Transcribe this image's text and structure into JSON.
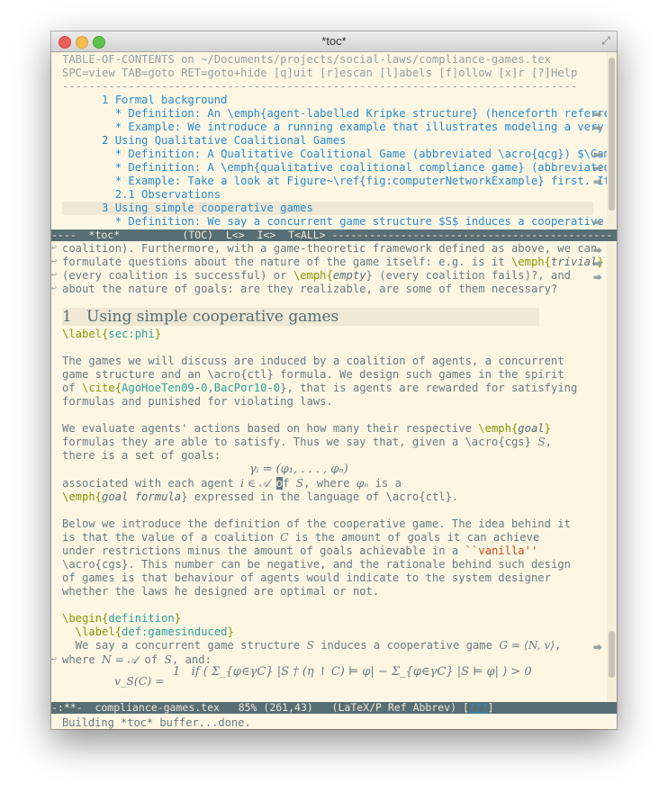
{
  "window": {
    "title": "*toc*"
  },
  "toc": {
    "header1": "TABLE-OF-CONTENTS on ~/Documents/projects/social-laws/compliance-games.tex",
    "header2": "SPC=view TAB=goto RET=goto+hide [q]uit [r]escan [l]abels [f]ollow [x]r [?]Help",
    "rule": "------------------------------------------------------------------------------",
    "entries": [
      "      1 Formal background",
      "        * Definition: An \\emph{agent-labelled Kripke structure} (henceforth referred",
      "        * Example: We introduce a running example that illustrates modeling a very si",
      "      2 Using Qualitative Coalitional Games",
      "        * Definition: A Qualitative Coalitional Game (abbreviated \\acro{qcg}) $\\Gamma",
      "        * Definition: A \\emph{qualitative coalitional compliance game} (abbreviated \\",
      "        * Example: Take a look at Figure~\\ref{fig:computerNetworkExample} first. It i",
      "        2.1 Observations",
      "      3 Using simple cooperative games",
      "        * Definition: We say a concurrent game structure $S$ induces a cooperative ga"
    ]
  },
  "modeline_top": "----  *toc*          (TOC)  L<>  I<>  T<ALL> ---------------------------------------------",
  "text": {
    "l1": "coalition). Furthermore, with a game-theoretic framework defined as above, we can",
    "l2": "formulate questions about the nature of the game itself: e.g. is it ",
    "l2_cmd": "\\emph{",
    "l2_arg": "trivial",
    "l2_end": "}",
    "l3_a": "(every coalition is successful) or ",
    "l3_cmd": "\\emph{",
    "l3_arg": "empty",
    "l3_b": "} (every coalition fails)?, and",
    "l4": "about the nature of goals: are they realizable, are some of them necessary?",
    "section": "1   Using simple cooperative games",
    "label_cmd": "\\label{",
    "label_arg": "sec:phi",
    "label_end": "}",
    "p1_1": "The games we will discuss are induced by a coalition of agents, a concurrent",
    "p1_2": "game structure and an \\acro{ctl} formula. We design such games in the spirit",
    "p1_3a": "of ",
    "p1_3cmd": "\\cite{",
    "p1_3arg": "AgoHoeTen09-0,BacPor10-0",
    "p1_3b": "}, that is agents are rewarded for satisfying",
    "p1_4": "formulas and punished for violating laws.",
    "p2_1a": "We evaluate agents' actions based on how many their respective ",
    "p2_1cmd": "\\emph{",
    "p2_1arg": "goal",
    "p2_1b": "}",
    "p2_2": "formulas they are able to satisfy. Thus we say that, given a \\acro{cgs} ",
    "p2_2m": "S",
    "p2_2e": ",",
    "p2_3": "there is a set of goals:",
    "eq1": "γᵢ = (φ₁, . . . , φₙ)",
    "p2_4a": "associated with each agent ",
    "p2_4m": "i ∈ 𝒜",
    "p2_4c": "o",
    "p2_4b": "f ",
    "p2_4m2": "S",
    "p2_4d": ", where ",
    "p2_4m3": "φₙ",
    "p2_4e": " is a",
    "p2_5cmd": "\\emph{",
    "p2_5arg": "goal formula",
    "p2_5b": "} expressed in the language of \\acro{ctl}.",
    "p3_1": "Below we introduce the definition of the cooperative game. The idea behind it",
    "p3_2a": "is that the value of a coalition ",
    "p3_2m": "C",
    "p3_2b": " is the amount of goals it can achieve",
    "p3_3a": "under restrictions minus the amount of goals achievable in a ",
    "p3_3q": "``vanilla''",
    "p3_4": "\\acro{cgs}. This number can be negative, and the rationale behind such design",
    "p3_5": "of games is that behaviour of agents would indicate to the system designer",
    "p3_6": "whether the laws he designed are optimal or not.",
    "begin_cmd": "\\begin{",
    "begin_arg": "definition",
    "begin_end": "}",
    "deflabel_cmd": "  \\label{",
    "deflabel_arg": "def:gamesinduced",
    "deflabel_end": "}",
    "d1a": "  We say a concurrent game structure ",
    "d1m": "S",
    "d1b": " induces a cooperative game ",
    "d1m2": "G = ⟨N, v⟩",
    "d1c": ",",
    "d2a": "where ",
    "d2m": "N = 𝒜",
    "d2b": " of ",
    "d2m2": "S",
    "d2c": ", and:",
    "eq2_lhs": "v_S(C) =",
    "eq2_rhs": "1   if ( Σ_{φ∈γC} |S † (η ↾ C) ⊨ φ| − Σ_{φ∈γC} |S ⊨ φ| ) > 0"
  },
  "modeline_bottom": "-:**-  compliance-games.tex   85% (261,43)   (LaTeX/P Ref Abbrev) [",
  "modeline_bottom_q": "???",
  "modeline_bottom_end": "]",
  "minibuffer": "Building *toc* buffer...done."
}
